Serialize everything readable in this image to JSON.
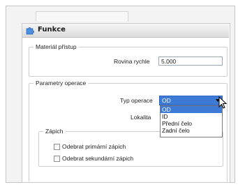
{
  "dialog": {
    "title": "Funkce"
  },
  "material": {
    "legend": "Materiál přístup",
    "speed_label": "Rovina rychle",
    "speed_value": "5.000"
  },
  "operation": {
    "legend": "Parametry operace",
    "type_label": "Typ operace",
    "type_value": "OD",
    "locality_label": "Lokalita",
    "options": [
      "OD",
      "ID",
      "Přední čelo",
      "Zadní čelo"
    ]
  },
  "insertion": {
    "legend": "Zápich",
    "remove_primary": "Odebrat primární zápich",
    "remove_secondary": "Odebrat sekundární zápich"
  },
  "colors": {
    "accent": "#3d7ad6"
  }
}
